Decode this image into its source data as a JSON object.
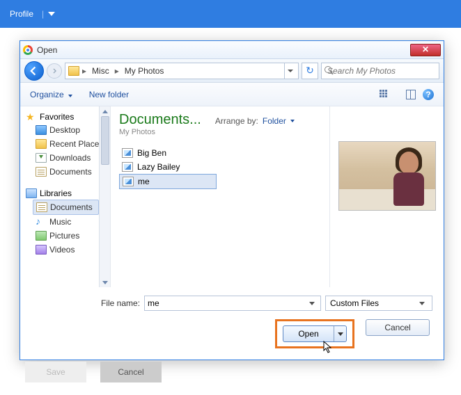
{
  "page": {
    "header_title": "Profile",
    "save_label": "Save",
    "cancel_label": "Cancel"
  },
  "dialog": {
    "title": "Open",
    "breadcrumb": {
      "seg1": "Misc",
      "seg2": "My Photos"
    },
    "search_placeholder": "Search My Photos",
    "toolbar": {
      "organize": "Organize",
      "new_folder": "New folder"
    },
    "sidebar": {
      "favorites": "Favorites",
      "desktop": "Desktop",
      "recent": "Recent Places",
      "downloads": "Downloads",
      "documents": "Documents",
      "libraries": "Libraries",
      "lib_documents": "Documents",
      "music": "Music",
      "pictures": "Pictures",
      "videos": "Videos"
    },
    "main": {
      "lib_title": "Documents...",
      "lib_sub": "My Photos",
      "arrange_label": "Arrange by:",
      "arrange_value": "Folder",
      "files": {
        "f0": "Big Ben",
        "f1": "Lazy Bailey",
        "f2": "me"
      }
    },
    "footer": {
      "filename_label": "File name:",
      "filename_value": "me",
      "filter_value": "Custom Files",
      "open_label": "Open",
      "cancel_label": "Cancel"
    }
  }
}
